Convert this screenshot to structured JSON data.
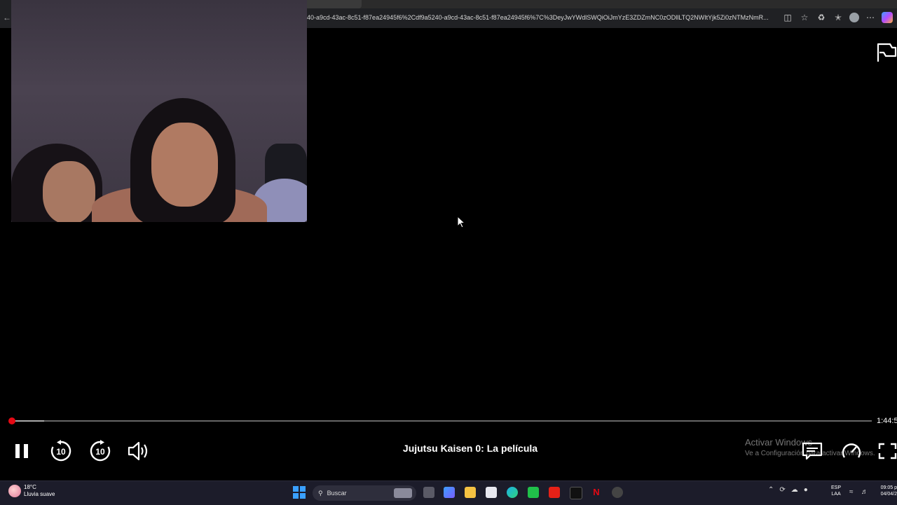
{
  "browser": {
    "address_url": "40-a9cd-43ac-8c51-f87ea24945f6%2Cdf9a5240-a9cd-43ac-8c51-f87ea24945f6%7C%3DeyJwYWdlSWQiOiJmYzE3ZDZmNC0zODllLTQ2NWItYjk5Zi0zNTMzNmR...",
    "icons": [
      "back-arrow-icon",
      "tab-icon",
      "star-icon",
      "favorites-icon",
      "profile-icon",
      "more-icon",
      "copilot-icon"
    ]
  },
  "player": {
    "title": "Jujutsu Kaisen 0: La película",
    "time_remaining": "1:44:5",
    "progress_fraction": 0.001,
    "buffer_fraction": 0.038,
    "rewind_label": "10",
    "forward_label": "10",
    "accent_color": "#e50914"
  },
  "watermark": {
    "line1": "Activar Windows",
    "line2": "Ve a Configuración para activar Windows."
  },
  "taskbar": {
    "weather_temp": "18°C",
    "weather_desc": "Lluvia suave",
    "search_placeholder": "Buscar",
    "lang_line1": "ESP",
    "lang_line2": "LAA",
    "time": "09:05 p",
    "date": "04/04/2"
  }
}
